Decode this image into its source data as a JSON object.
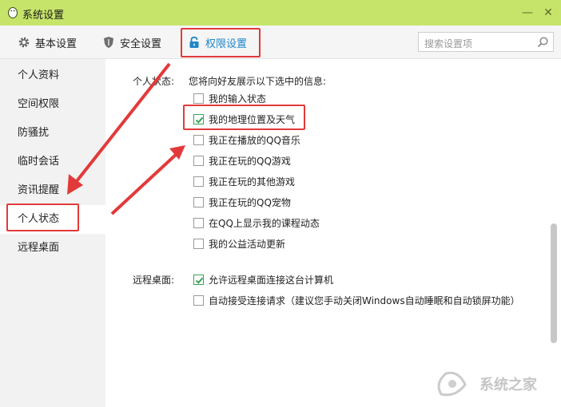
{
  "window": {
    "title": "系统设置",
    "minimize_glyph": "—",
    "close_glyph": "✕"
  },
  "toolbar": {
    "tabs": [
      {
        "label": "基本设置",
        "icon": "gear-icon"
      },
      {
        "label": "安全设置",
        "icon": "shield-icon"
      },
      {
        "label": "权限设置",
        "icon": "lock-icon",
        "active": true
      }
    ],
    "search_placeholder": "搜索设置项"
  },
  "sidebar": {
    "items": [
      {
        "label": "个人资料"
      },
      {
        "label": "空间权限"
      },
      {
        "label": "防骚扰"
      },
      {
        "label": "临时会话"
      },
      {
        "label": "资讯提醒"
      },
      {
        "label": "个人状态",
        "active": true
      },
      {
        "label": "远程桌面"
      }
    ]
  },
  "content": {
    "personal_status": {
      "label": "个人状态:",
      "desc": "您将向好友展示以下选中的信息:",
      "options": [
        {
          "label": "我的输入状态",
          "checked": false
        },
        {
          "label": "我的地理位置及天气",
          "checked": true
        },
        {
          "label": "我正在播放的QQ音乐",
          "checked": false
        },
        {
          "label": "我正在玩的QQ游戏",
          "checked": false
        },
        {
          "label": "我正在玩的其他游戏",
          "checked": false
        },
        {
          "label": "我正在玩的QQ宠物",
          "checked": false
        },
        {
          "label": "在QQ上显示我的课程动态",
          "checked": false
        },
        {
          "label": "我的公益活动更新",
          "checked": false
        }
      ]
    },
    "remote_desktop": {
      "label": "远程桌面:",
      "options": [
        {
          "label": "允许远程桌面连接这台计算机",
          "checked": true
        },
        {
          "label": "自动接受连接请求（建议您手动关闭Windows自动睡眠和自动锁屏功能）",
          "checked": false
        }
      ]
    }
  },
  "watermark": {
    "text": "系统之家"
  },
  "colors": {
    "titlebar": "#c6e46a",
    "accent": "#1f86c9",
    "highlight": "#e23a3a",
    "check": "#3aa35a"
  }
}
